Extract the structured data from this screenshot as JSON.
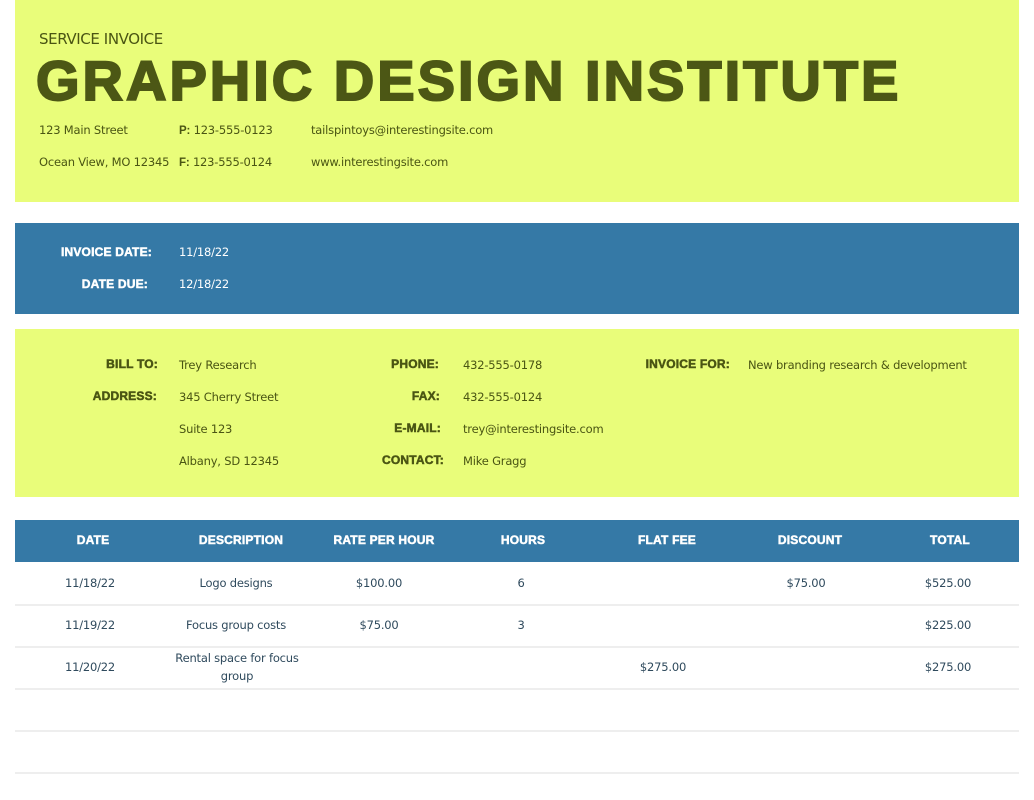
{
  "header": {
    "service_title": "SERVICE INVOICE",
    "company_name": "GRAPHIC DESIGN INSTITUTE",
    "address_line1": "123 Main Street",
    "address_line2": "Ocean View, MO 12345",
    "phone_label": "P:",
    "phone": "123-555-0123",
    "fax_label": "F:",
    "fax": "123-555-0124",
    "email": "tailspintoys@interestingsite.com",
    "website": "www.interestingsite.com"
  },
  "dates": {
    "invoice_date_label": "INVOICE DATE:",
    "invoice_date": "11/18/22",
    "due_date_label": "DATE DUE:",
    "due_date": "12/18/22"
  },
  "billing": {
    "bill_to_label": "BILL TO:",
    "bill_to": "Trey Research",
    "address_label": "ADDRESS:",
    "address_line1": "345 Cherry Street",
    "address_line2": "Suite 123",
    "address_line3": "Albany, SD 12345",
    "phone_label": "PHONE:",
    "phone": "432-555-0178",
    "fax_label": "FAX:",
    "fax": "432-555-0124",
    "email_label": "E-MAIL:",
    "email": "trey@interestingsite.com",
    "contact_label": "CONTACT:",
    "contact": "Mike Gragg",
    "invoice_for_label": "INVOICE FOR:",
    "invoice_for": "New branding research & development"
  },
  "table": {
    "columns": [
      "DATE",
      "DESCRIPTION",
      "RATE PER HOUR",
      "HOURS",
      "FLAT FEE",
      "DISCOUNT",
      "TOTAL"
    ],
    "rows": [
      [
        "11/18/22",
        "Logo designs",
        "$100.00",
        "6",
        "",
        "$75.00",
        "$525.00"
      ],
      [
        "11/19/22",
        "Focus group costs",
        "$75.00",
        "3",
        "",
        "",
        "$225.00"
      ],
      [
        "11/20/22",
        "Rental space for focus group",
        "",
        "",
        "$275.00",
        "",
        "$275.00"
      ],
      [
        "",
        "",
        "",
        "",
        "",
        "",
        ""
      ],
      [
        "",
        "",
        "",
        "",
        "",
        "",
        ""
      ]
    ]
  },
  "colors": {
    "accent_yellow": "#e9fd7a",
    "accent_blue": "#3579a6",
    "text_olive": "#4a5513"
  }
}
